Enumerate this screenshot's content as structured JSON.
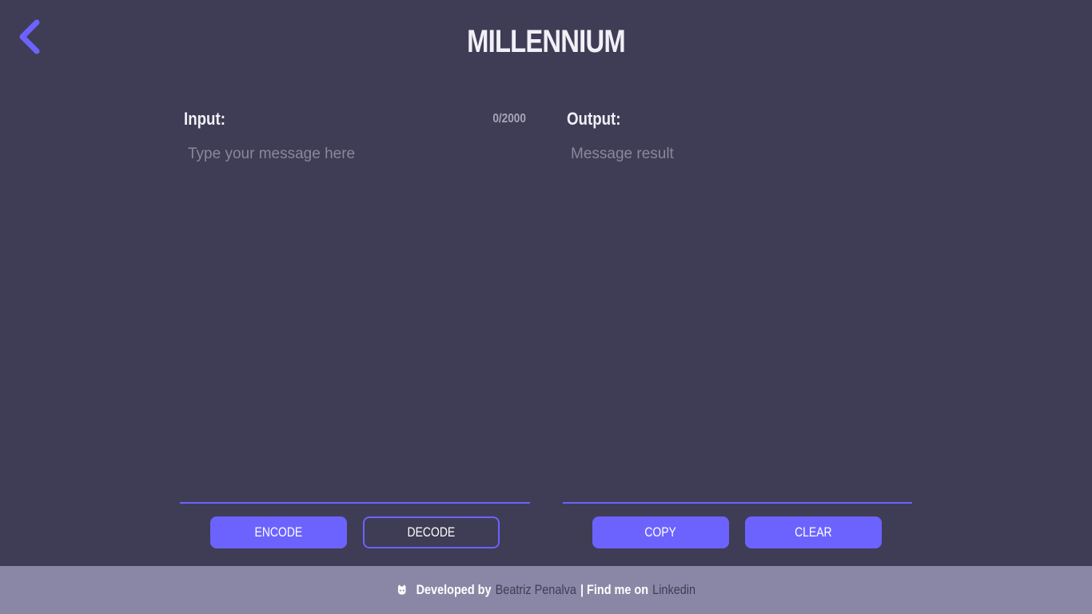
{
  "header": {
    "title": "MILLENNIUM",
    "back_icon": "chevron-left-icon"
  },
  "colors": {
    "background": "#3f3c55",
    "accent": "#6c63ff",
    "footer": "#8a87a6",
    "text": "#f2f0f7"
  },
  "input_panel": {
    "label": "Input:",
    "counter": "0/2000",
    "placeholder": "Type your message here",
    "value": ""
  },
  "output_panel": {
    "label": "Output:",
    "placeholder": "Message result",
    "value": ""
  },
  "buttons": {
    "encode": "ENCODE",
    "decode": "DECODE",
    "copy": "COPY",
    "clear": "CLEAR"
  },
  "footer": {
    "icon": "github-icon",
    "developed_by": "Developed by",
    "author": "Beatriz Penalva",
    "find_me": "| Find me on",
    "linkedin": "Linkedin"
  }
}
